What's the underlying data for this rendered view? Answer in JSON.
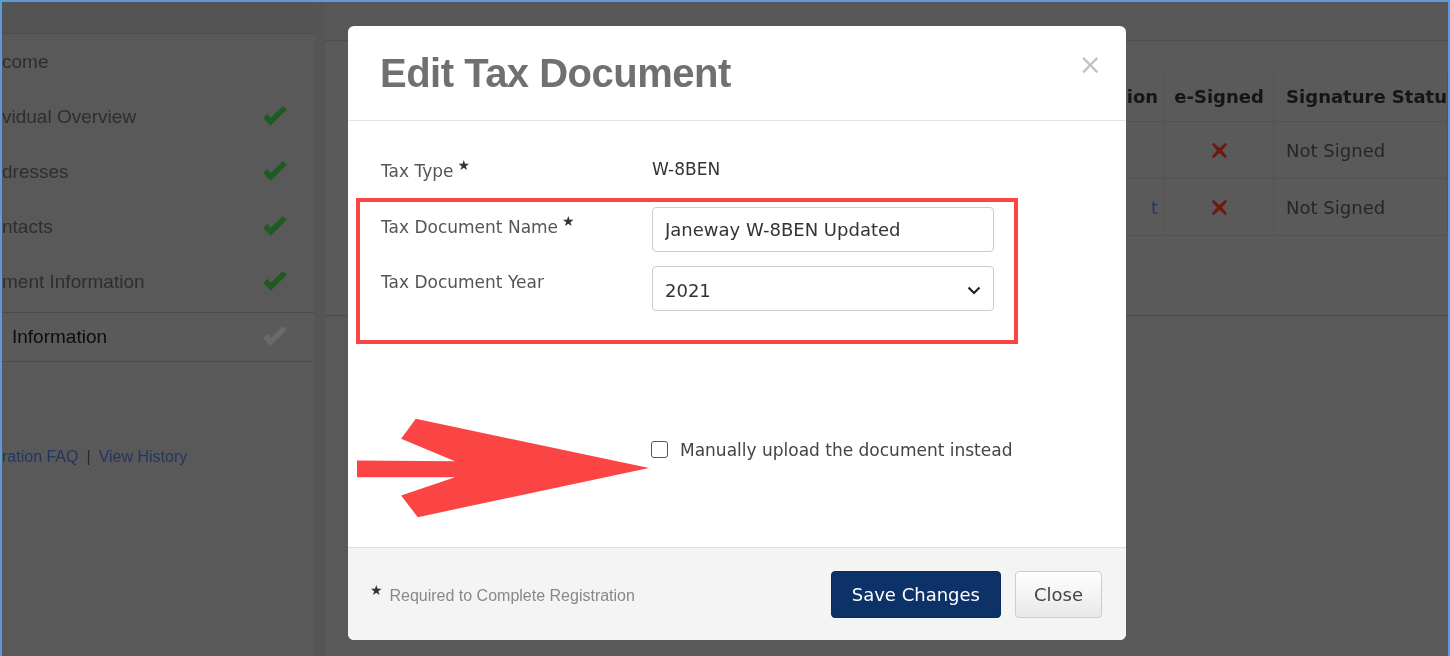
{
  "sidebar": {
    "items": [
      {
        "label": "come",
        "kind": "plain",
        "selected": false
      },
      {
        "label": "vidual Overview",
        "kind": "step",
        "checked": true,
        "selected": false
      },
      {
        "label": "dresses",
        "kind": "step",
        "checked": true,
        "selected": false
      },
      {
        "label": "ntacts",
        "kind": "step",
        "checked": true,
        "selected": false
      },
      {
        "label": "ment Information",
        "kind": "step",
        "checked": true,
        "selected": false
      },
      {
        "label": "Information",
        "kind": "step",
        "checked": false,
        "selected": true
      }
    ],
    "links": [
      "ration FAQ",
      "View History"
    ],
    "link_separator": "|"
  },
  "table": {
    "columns": [
      "ion",
      "e-Signed",
      "Signature Statu"
    ],
    "rows": [
      {
        "e_signed": false,
        "signature_status": "Not Signed"
      },
      {
        "column_1": "t",
        "e_signed": false,
        "signature_status": "Not Signed"
      }
    ]
  },
  "modal": {
    "title": "Edit Tax Document",
    "close": "×",
    "tax_type": {
      "label": "Tax Type",
      "required": true,
      "value": "W-8BEN"
    },
    "name_field": {
      "label": "Tax Document Name",
      "required": true,
      "value": "Janeway W-8BEN Updated"
    },
    "year_field": {
      "label": "Tax Document Year",
      "value": "2021"
    },
    "manual_upload": {
      "label": "Manually upload the document instead",
      "checked": false
    },
    "required_mark": "★",
    "footer_note": "Required to Complete Registration",
    "buttons": [
      "Save Changes",
      "Close"
    ]
  }
}
